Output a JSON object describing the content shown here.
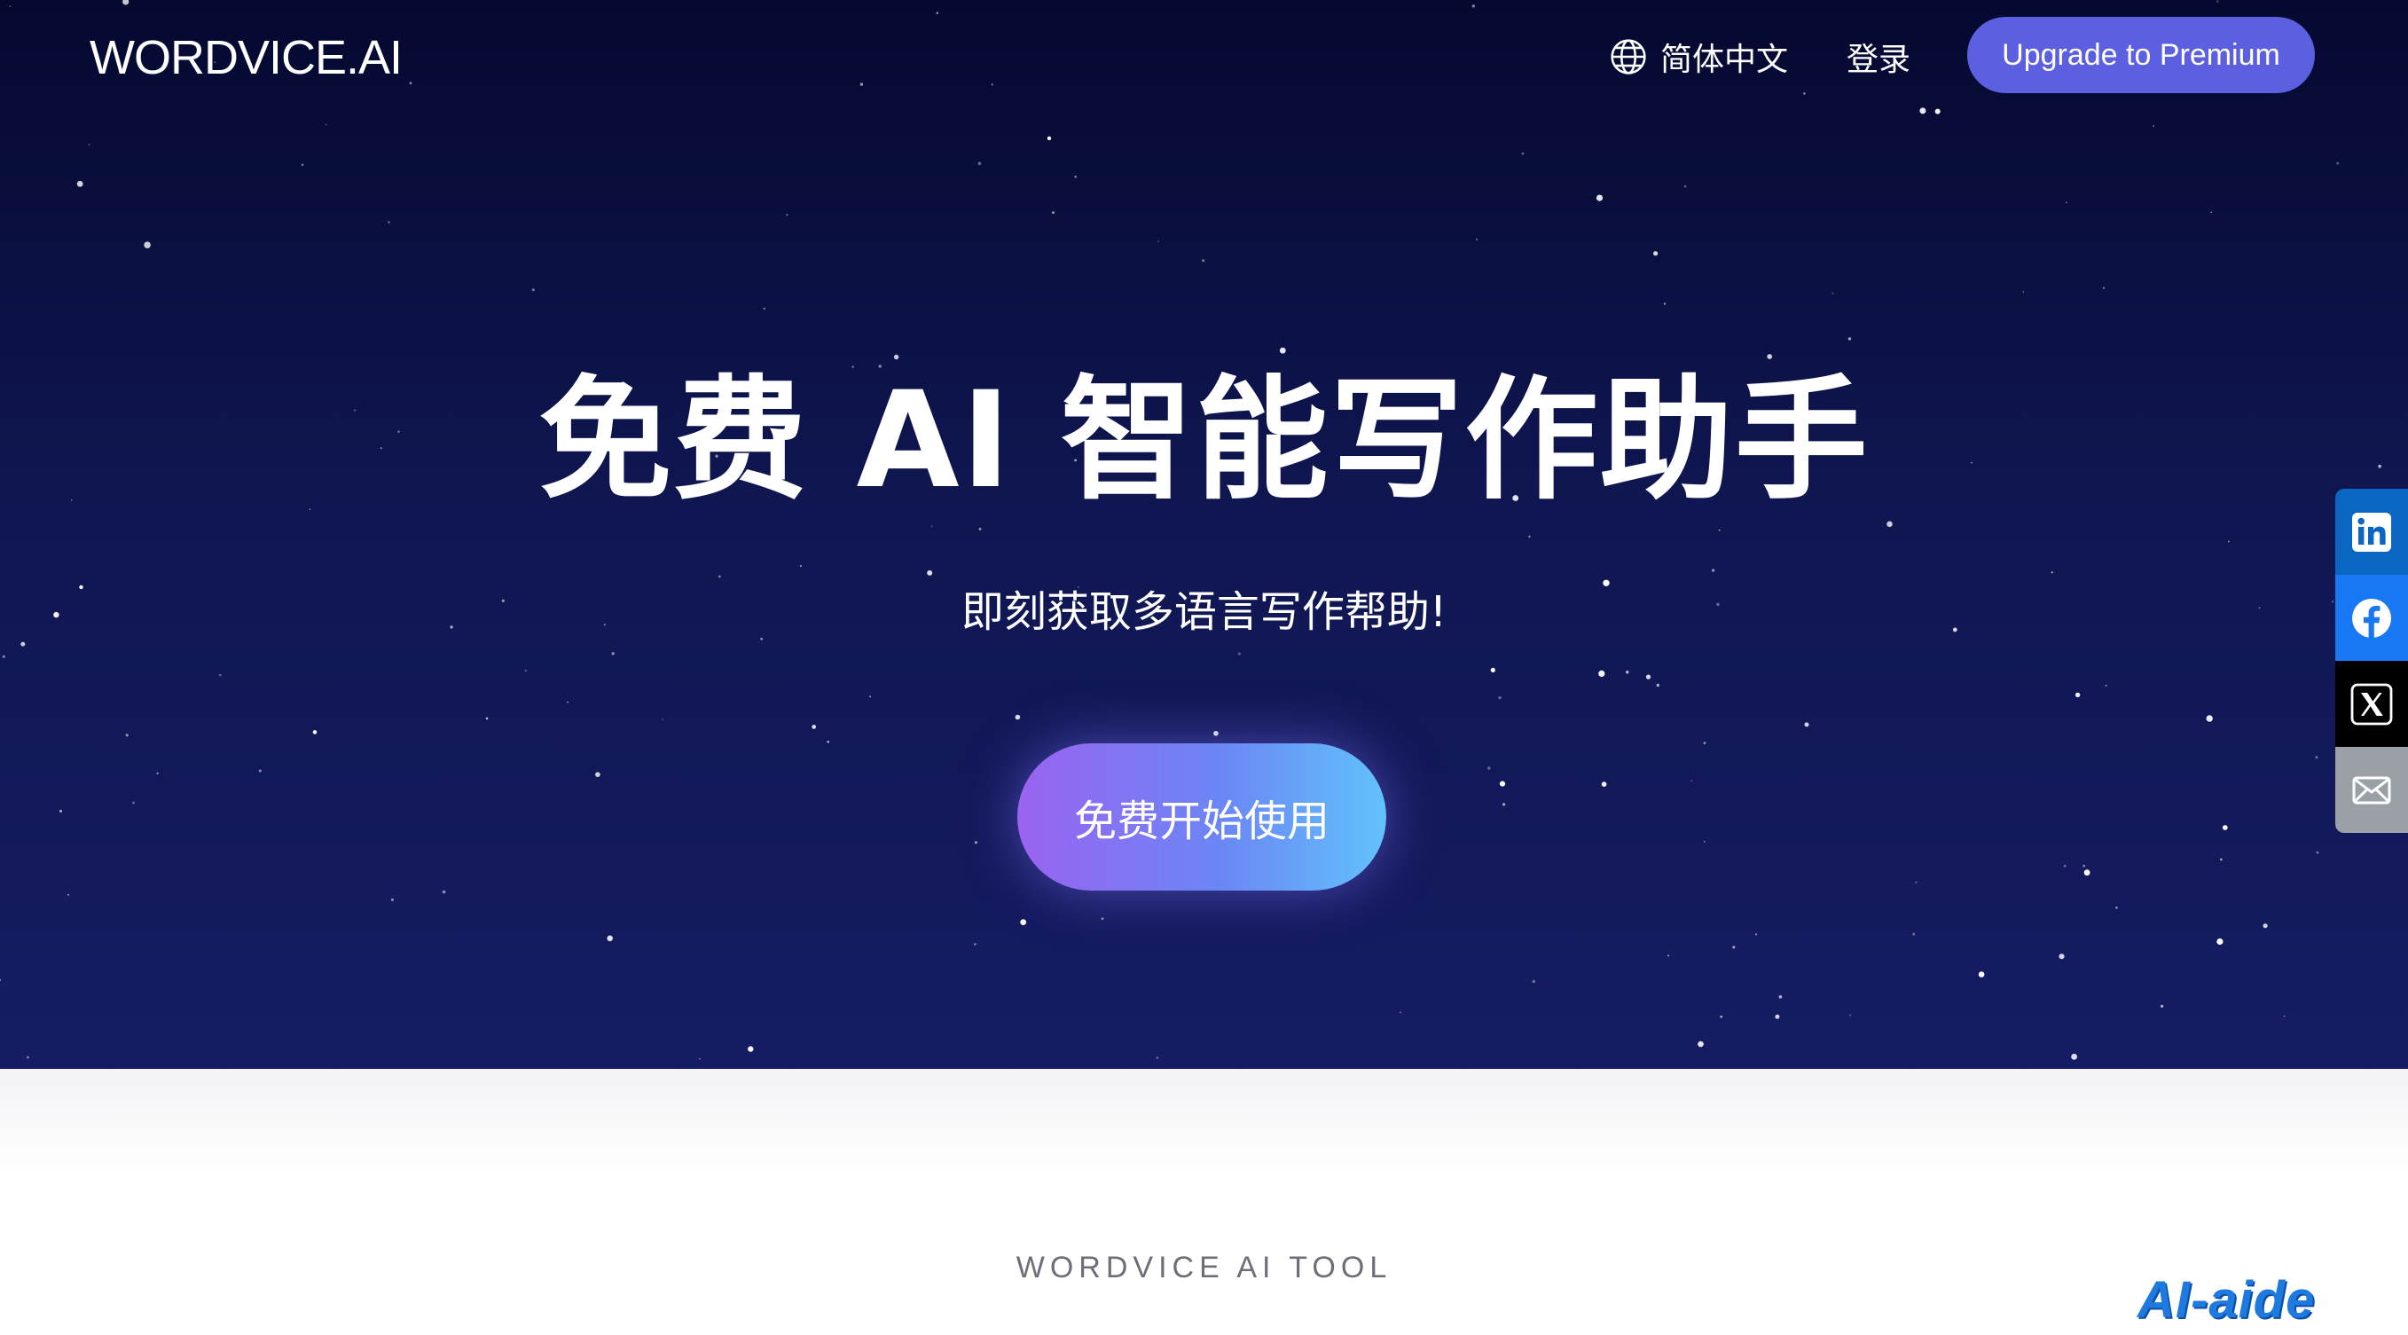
{
  "header": {
    "logo": "WORDVICE.AI",
    "language_label": "简体中文",
    "language_icon": "globe-icon",
    "login_label": "登录",
    "premium_label": "Upgrade to Premium"
  },
  "hero": {
    "title": "免费 AI 智能写作助手",
    "subtitle": "即刻获取多语言写作帮助!",
    "cta_label": "免费开始使用"
  },
  "social": [
    {
      "name": "linkedin",
      "icon": "linkedin-icon",
      "color": "#0a66c2"
    },
    {
      "name": "facebook",
      "icon": "facebook-icon",
      "color": "#1877f2"
    },
    {
      "name": "x",
      "icon": "x-icon",
      "color": "#000000"
    },
    {
      "name": "email",
      "icon": "mail-icon",
      "color": "#9aa0a6"
    }
  ],
  "section": {
    "label": "WORDVICE AI TOOL"
  },
  "watermark": "AI-aide",
  "colors": {
    "premium_button": "#5b5fe0",
    "hero_background": "#0f1650",
    "cta_gradient_start": "#9a63f0",
    "cta_gradient_end": "#61c2fb"
  }
}
